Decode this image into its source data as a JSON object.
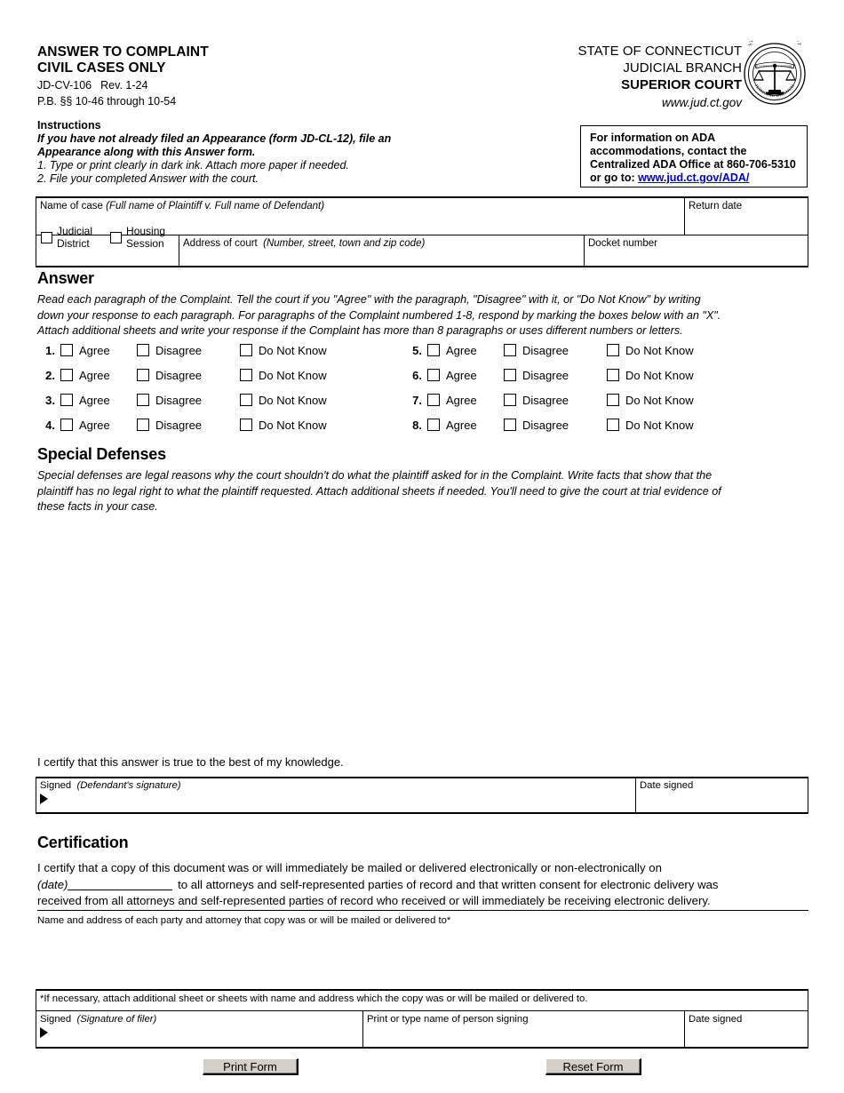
{
  "header": {
    "form_title_line1": "ANSWER TO COMPLAINT",
    "form_title_line2": "CIVIL CASES ONLY",
    "form_code": "JD-CV-106",
    "form_rev": "Rev. 1-24",
    "practice_book": "P.B. §§ 10-46 through 10-54",
    "agency_line1": "STATE OF CONNECTICUT",
    "agency_line2": "JUDICIAL BRANCH",
    "agency_line3": "SUPERIOR COURT",
    "agency_url": "www.jud.ct.gov",
    "seal_outer_top": "STATE OF CONNECTICUT",
    "seal_outer_bottom": "JUDICIAL BRANCH",
    "seal_motto": "QUI TRANSTULIT SUSTINET"
  },
  "instructions": {
    "heading": "Instructions",
    "bold_line1": "If you have not already filed an Appearance (form JD-CL-12), file an",
    "bold_line2": "Appearance along with this Answer form.",
    "item1": "1. Type or print clearly in dark ink. Attach more paper if needed.",
    "item2": "2. File your completed Answer with the court."
  },
  "ada": {
    "line1": "For information on ADA",
    "line2": "accommodations, contact the",
    "line3": "Centralized ADA Office at 860-706-5310",
    "line4_prefix": "or go to: ",
    "link_text": "www.jud.ct.gov/ADA/",
    "link_color": "#0000cc"
  },
  "case_table": {
    "name_of_case_label": "Name of case",
    "name_of_case_hint": "(Full name of Plaintiff v. Full name of Defendant)",
    "return_date_label": "Return date",
    "judicial_district_line1": "Judicial",
    "judicial_district_line2": "District",
    "housing_session_line1": "Housing",
    "housing_session_line2": "Session",
    "address_of_court_label": "Address of court",
    "address_of_court_hint": "(Number, street, town and zip code)",
    "docket_number_label": "Docket number",
    "name_of_case_value": "",
    "return_date_value": "",
    "address_of_court_value": "",
    "docket_number_value": "",
    "judicial_district_checked": false,
    "housing_session_checked": false
  },
  "answer": {
    "title": "Answer",
    "intro_line1": "Read each paragraph of the Complaint. Tell the court if you \"Agree\" with the paragraph, \"Disagree\" with it, or \"Do Not Know\" by writing",
    "intro_line2": "down your response to each paragraph. For paragraphs of the Complaint numbered 1-8, respond by marking the boxes below with an \"X\".",
    "intro_line3": "Attach additional sheets and write your response if the Complaint has more than 8 paragraphs or uses different numbers or letters.",
    "options": [
      "Agree",
      "Disagree",
      "Do Not Know"
    ],
    "rows": [
      {
        "number": "1.",
        "agree": false,
        "disagree": false,
        "do_not_know": false
      },
      {
        "number": "2.",
        "agree": false,
        "disagree": false,
        "do_not_know": false
      },
      {
        "number": "3.",
        "agree": false,
        "disagree": false,
        "do_not_know": false
      },
      {
        "number": "4.",
        "agree": false,
        "disagree": false,
        "do_not_know": false
      },
      {
        "number": "5.",
        "agree": false,
        "disagree": false,
        "do_not_know": false
      },
      {
        "number": "6.",
        "agree": false,
        "disagree": false,
        "do_not_know": false
      },
      {
        "number": "7.",
        "agree": false,
        "disagree": false,
        "do_not_know": false
      },
      {
        "number": "8.",
        "agree": false,
        "disagree": false,
        "do_not_know": false
      }
    ]
  },
  "special_defenses": {
    "title": "Special Defenses",
    "intro_line1": "Special defenses are legal reasons why the court shouldn't do what the plaintiff asked for in the Complaint. Write facts that show that the",
    "intro_line2": "plaintiff has no legal right to what the plaintiff requested. Attach additional sheets if needed. You'll need to give the court at trial evidence of",
    "intro_line3": "these facts in your case.",
    "text_value": ""
  },
  "answer_signature": {
    "certify_statement": "I certify that this answer is true to the best of my knowledge.",
    "signed_label": "Signed",
    "signed_hint": "(Defendant's signature)",
    "date_signed_label": "Date signed",
    "signed_value": "",
    "date_signed_value": ""
  },
  "certification": {
    "title": "Certification",
    "line1": "I certify that a copy of this document was or will immediately be mailed or delivered electronically or non-electronically on",
    "line2_prefix": "(date)",
    "line2_suffix": "to all attorneys and self-represented parties of record and that written consent for electronic delivery was",
    "line3": "received from all attorneys and self-represented parties of record who received or will immediately be receiving electronic delivery.",
    "date_value": "",
    "names_label": "Name and address of each party and attorney that copy was or will be mailed or delivered to*",
    "names_value": "",
    "footnote": "*If necessary, attach additional sheet or sheets with name and address which the copy was or will be mailed or delivered to."
  },
  "filer_signature": {
    "signed_label": "Signed",
    "signed_hint": "(Signature of filer)",
    "print_name_label": "Print or type name of person signing",
    "date_signed_label": "Date signed",
    "signed_value": "",
    "print_name_value": "",
    "date_signed_value": ""
  },
  "buttons": {
    "print_form": "Print Form",
    "reset_form": "Reset Form"
  }
}
